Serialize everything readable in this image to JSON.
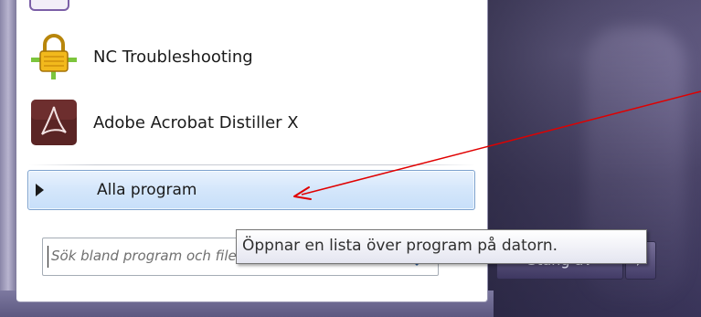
{
  "start_menu": {
    "pinned_programs": [
      {
        "label": "NC Troubleshooting",
        "icon": "padlock-network-icon"
      },
      {
        "label": "Adobe Acrobat Distiller X",
        "icon": "adobe-acrobat-icon"
      }
    ],
    "all_programs": {
      "label": "Alla program",
      "icon": "triangle-right-icon"
    },
    "search": {
      "placeholder": "Sök bland program och filer",
      "icon": "search-icon"
    },
    "power": {
      "label": "Stäng av",
      "icon": "triangle-right-icon"
    }
  },
  "tooltip": {
    "text": "Öppnar en lista över program på datorn."
  },
  "annotation": {
    "icon": "red-arrow-icon",
    "color": "#e00000"
  },
  "colors": {
    "selection_bg": "#d4e6fb",
    "selection_border": "#7da2ce"
  }
}
